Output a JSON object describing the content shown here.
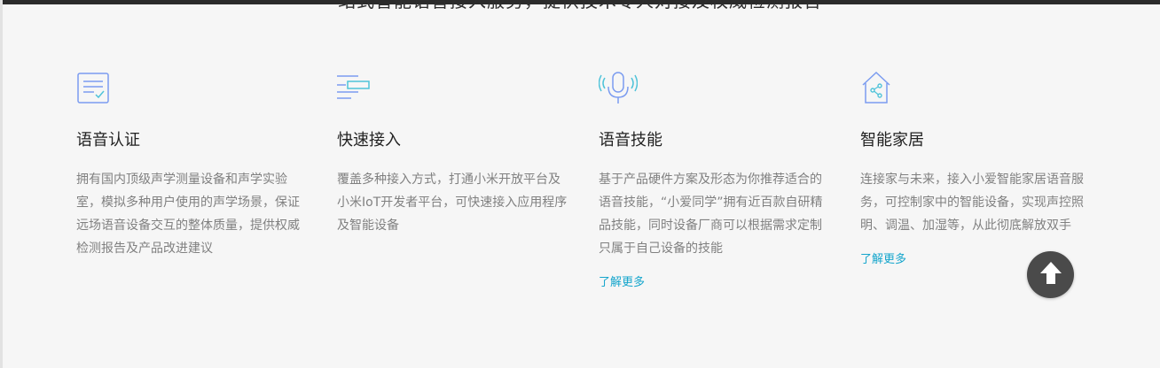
{
  "section": {
    "partial_heading": "站式智能语音接入服务，提供技术专人对接及权威检测报告"
  },
  "features": [
    {
      "title": "语音认证",
      "desc": "拥有国内顶级声学测量设备和声学实验室，模拟多种用户使用的声学场景，保证远场语音设备交互的整体质量，提供权威检测报告及产品改进建议",
      "icon": "certificate-check-icon"
    },
    {
      "title": "快速接入",
      "desc": "覆盖多种接入方式，打通小米开放平台及小米IoT开发者平台，可快速接入应用程序及智能设备",
      "icon": "fast-access-lines-icon"
    },
    {
      "title": "语音技能",
      "desc": "基于产品硬件方案及形态为你推荐适合的语音技能，“小爱同学”拥有近百款自研精品技能，同时设备厂商可以根据需求定制只属于自己设备的技能",
      "more": "了解更多",
      "icon": "microphone-icon"
    },
    {
      "title": "智能家居",
      "desc": "连接家与未来，接入小爱智能家居语音服务，可控制家中的智能设备，实现声控照明、调温、加湿等，从此彻底解放双手",
      "more": "了解更多",
      "icon": "smart-home-icon"
    }
  ],
  "colors": {
    "icon_blue": "#7b9cf0",
    "icon_cyan": "#4fc3d9",
    "link": "#14a5cc"
  },
  "scroll_top": {
    "icon": "arrow-up-icon"
  }
}
